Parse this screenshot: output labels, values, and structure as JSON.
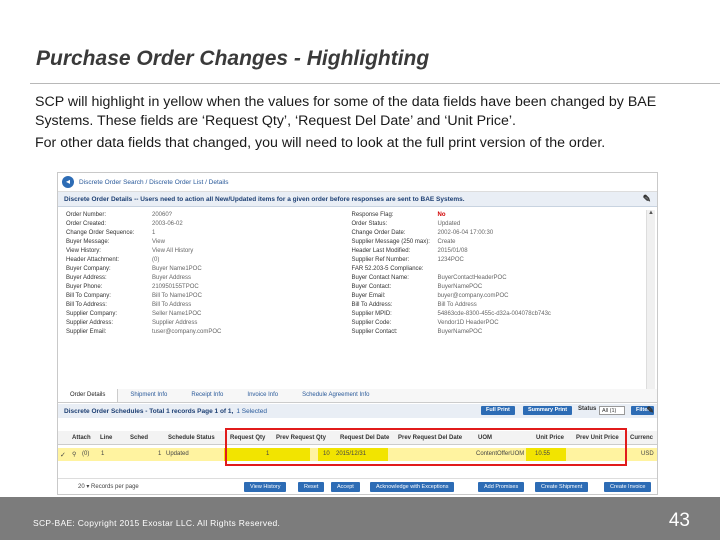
{
  "slide": {
    "title": "Purchase Order Changes - Highlighting",
    "paragraph_1": "SCP will highlight in yellow when the values for some of the data fields have been changed by BAE Systems.  These fields are ‘Request Qty’, ‘Request Del Date’ and ‘Unit Price’.",
    "paragraph_2": "For other data fields that changed, you will need to look at the full print version of the order.",
    "footer": "SCP-BAE:  Copyright 2015 Exostar LLC. All Rights Reserved.",
    "page_number": "43"
  },
  "app": {
    "breadcrumb": "Discrete Order Search / Discrete Order List / Details",
    "details_header": "Discrete Order Details -- Users need to action all New/Updated items for a given order before responses are sent to BAE Systems.",
    "left_fields": [
      {
        "k": "Order Number:",
        "v": "20060?"
      },
      {
        "k": "Order Created:",
        "v": "2003-06-02"
      },
      {
        "k": "Change Order Sequence:",
        "v": "1"
      },
      {
        "k": "Buyer Message:",
        "v": "View"
      },
      {
        "k": "View History:",
        "v": "View All History"
      },
      {
        "k": "Header Attachment:",
        "v": "(0)"
      },
      {
        "k": "Buyer Company:",
        "v": "Buyer Name1POC"
      },
      {
        "k": "Buyer Address:",
        "v": "Buyer Address"
      },
      {
        "k": "Buyer Phone:",
        "v": "210950155TPOC"
      },
      {
        "k": "Bill To Company:",
        "v": "Bill To Name1POC"
      },
      {
        "k": "Bill To Address:",
        "v": "Bill To Address"
      },
      {
        "k": "Supplier Company:",
        "v": "Seller Name1POC"
      },
      {
        "k": "Supplier Address:",
        "v": "Supplier Address"
      },
      {
        "k": "Supplier Email:",
        "v": "tuser@company.comPOC"
      }
    ],
    "right_fields": [
      {
        "k": "Response Flag:",
        "v": "No",
        "red": true
      },
      {
        "k": "Order Status:",
        "v": "Updated"
      },
      {
        "k": "Change Order Date:",
        "v": "2002-06-04 17:00:30"
      },
      {
        "k": "Supplier Message (250 max):",
        "v": "Create"
      },
      {
        "k": "Header Last Modified:",
        "v": "2015/01/08"
      },
      {
        "k": "Supplier Ref Number:",
        "v": "1234POC"
      },
      {
        "k": "FAR 52.203-5 Compliance:",
        "v": ""
      },
      {
        "k": "Buyer Contact Name:",
        "v": "BuyerContactHeaderPOC"
      },
      {
        "k": "Buyer Contact:",
        "v": "BuyerNamePOC"
      },
      {
        "k": "Buyer Email:",
        "v": "buyer@company.comPOC"
      },
      {
        "k": "Bill To Address:",
        "v": "Bill To Address"
      },
      {
        "k": "Supplier MPID:",
        "v": "54863cde-8300-455c-d32a-004078cb743c"
      },
      {
        "k": "Supplier Code:",
        "v": "Vendor1D HeaderPOC"
      },
      {
        "k": "Supplier Contact:",
        "v": "BuyerNamePOC"
      }
    ],
    "tabs": [
      "Order Details",
      "Shipment Info",
      "Receipt Info",
      "Invoice Info",
      "Schedule Agreement Info"
    ],
    "schedules_title": "Discrete Order Schedules - Total 1 records Page 1 of 1,",
    "selected_text": "1 Selected",
    "full_print": "Full Print",
    "summary_print": "Summary Print",
    "status_label": "Status",
    "status_value": "All (1)",
    "filter": "Filter",
    "columns": [
      "Attach",
      "Line",
      "Sched",
      "Schedule Status",
      "Request Qty",
      "Prev Request Qty",
      "Request Del Date",
      "Prev Request Del Date",
      "UOM",
      "Unit Price",
      "Prev Unit Price",
      "Currenc"
    ],
    "row": {
      "attach": "(0)",
      "line": "1",
      "sched": "1",
      "status": "Updated",
      "req_qty": "1",
      "prev_req_qty": "10",
      "req_del_date": "2015/12/31",
      "uom": "ContentOfferUOM",
      "unit_price": "10.55",
      "currency": "USD"
    },
    "pager_value": "20",
    "pager_text": "Records per page",
    "buttons": [
      "View History",
      "Reset",
      "Accept",
      "Acknowledge with Exceptions",
      "Add Promises",
      "Create Shipment",
      "Create Invoice"
    ]
  }
}
